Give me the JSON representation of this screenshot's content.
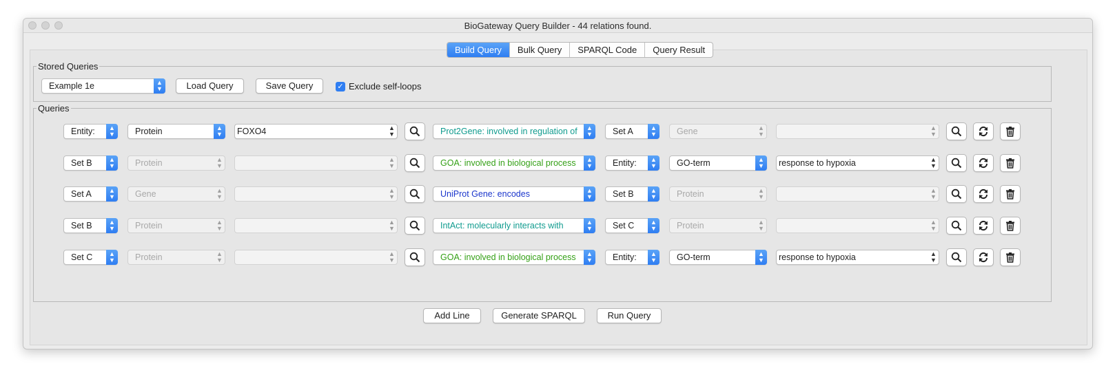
{
  "window": {
    "title": "BioGateway Query Builder - 44 relations found."
  },
  "tabs": [
    {
      "label": "Build Query",
      "active": true
    },
    {
      "label": "Bulk Query",
      "active": false
    },
    {
      "label": "SPARQL Code",
      "active": false
    },
    {
      "label": "Query Result",
      "active": false
    }
  ],
  "stored_queries": {
    "label": "Stored Queries",
    "selected": "Example 1e",
    "load_label": "Load Query",
    "save_label": "Save Query",
    "exclude_label": "Exclude self-loops",
    "exclude_checked": true
  },
  "queries": {
    "label": "Queries",
    "rows": [
      {
        "subject_set": "Entity:",
        "subject_type": "Protein",
        "subject_value": "FOXO4",
        "relation": "Prot2Gene: involved in regulation of",
        "relation_color": "#0f9b8e",
        "object_set": "Set A",
        "object_type": "Gene",
        "object_value": ""
      },
      {
        "subject_set": "Set B",
        "subject_type": "Protein",
        "subject_value": "",
        "relation": "GOA: involved in biological process",
        "relation_color": "#34a016",
        "object_set": "Entity:",
        "object_type": "GO-term",
        "object_value": "response to hypoxia"
      },
      {
        "subject_set": "Set A",
        "subject_type": "Gene",
        "subject_value": "",
        "relation": "UniProt Gene: encodes",
        "relation_color": "#1b36cc",
        "object_set": "Set B",
        "object_type": "Protein",
        "object_value": ""
      },
      {
        "subject_set": "Set B",
        "subject_type": "Protein",
        "subject_value": "",
        "relation": "IntAct: molecularly interacts with",
        "relation_color": "#0f9b8e",
        "object_set": "Set C",
        "object_type": "Protein",
        "object_value": ""
      },
      {
        "subject_set": "Set C",
        "subject_type": "Protein",
        "subject_value": "",
        "relation": "GOA: involved in biological process",
        "relation_color": "#34a016",
        "object_set": "Entity:",
        "object_type": "GO-term",
        "object_value": "response to hypoxia"
      }
    ]
  },
  "footer": {
    "add_line_label": "Add Line",
    "generate_label": "Generate SPARQL",
    "run_label": "Run Query"
  },
  "icons": {
    "search": "search-icon",
    "swap": "swap-icon",
    "delete": "trash-icon"
  },
  "colors": {
    "accent": "#2f7ef2"
  }
}
